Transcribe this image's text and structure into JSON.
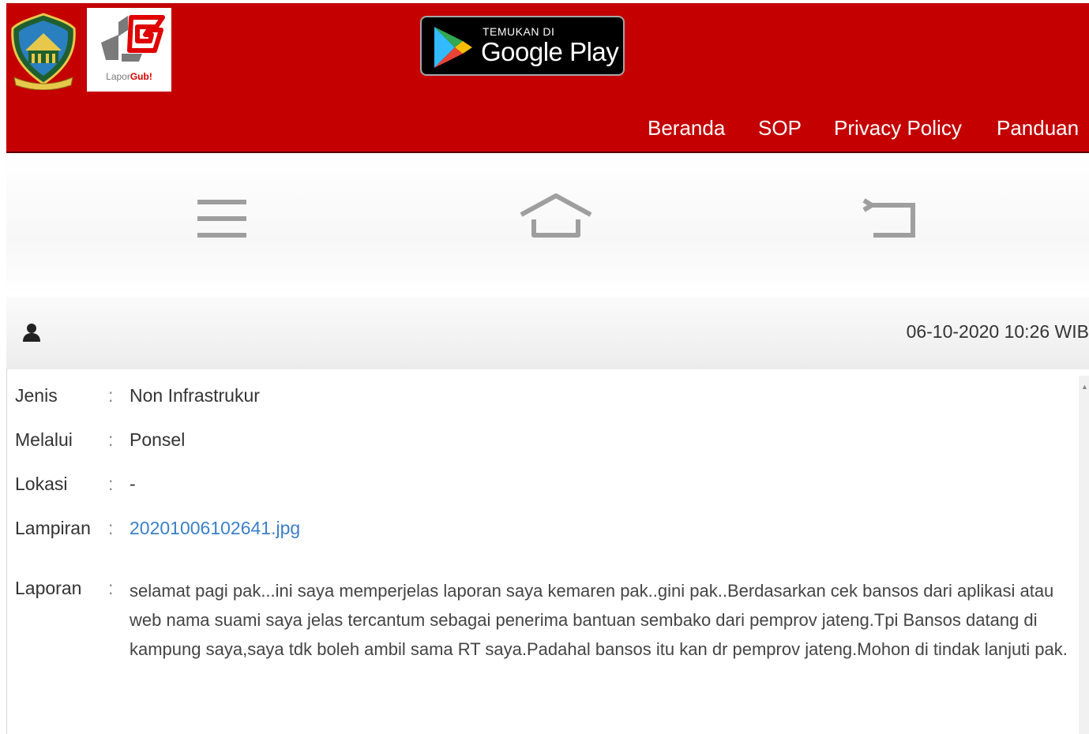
{
  "header": {
    "logo_province_alt": "Provinsi Jawa Tengah",
    "logo_lapor": {
      "text_part1": "Lapor",
      "text_part2": "Gub!"
    },
    "google_play": {
      "small_text": "TEMUKAN DI",
      "big_text": "Google Play"
    },
    "nav": [
      {
        "label": "Beranda"
      },
      {
        "label": "SOP"
      },
      {
        "label": "Privacy Policy"
      },
      {
        "label": "Panduan"
      }
    ]
  },
  "colors": {
    "brand_red": "#c40000",
    "link_blue": "#3c7fc9"
  },
  "phone_nav": {
    "icons": [
      "menu-icon",
      "home-icon",
      "back-icon"
    ]
  },
  "report": {
    "timestamp": "06-10-2020 10:26 WIB",
    "fields": [
      {
        "label": "Jenis",
        "value": "Non Infrastrukur"
      },
      {
        "label": "Melalui",
        "value": "Ponsel"
      },
      {
        "label": "Lokasi",
        "value": "-"
      },
      {
        "label": "Lampiran",
        "value": "20201006102641.jpg"
      }
    ],
    "colon": ":",
    "laporan_label": "Laporan",
    "laporan_text": "selamat pagi pak...ini saya memperjelas laporan saya kemaren pak..gini pak..Berdasarkan cek bansos dari aplikasi atau web nama suami saya jelas tercantum sebagai penerima bantuan sembako dari pemprov jateng.Tpi Bansos datang di kampung saya,saya tdk boleh ambil sama RT saya.Padahal bansos itu kan dr pemprov jateng.Mohon di tindak lanjuti pak."
  }
}
